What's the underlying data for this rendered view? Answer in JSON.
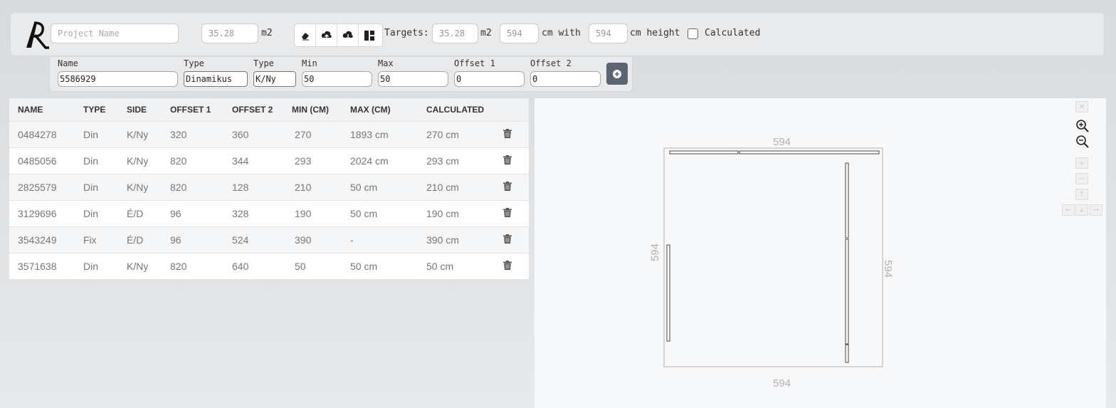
{
  "toolbar": {
    "project_name_placeholder": "Project Name",
    "area_value": "35.28",
    "area_unit": "m2",
    "targets_label": "Targets:",
    "target_area_value": "35.28",
    "target_area_unit": "m2",
    "width_value": "594",
    "width_suffix": "cm with",
    "height_value": "594",
    "height_suffix": "cm height",
    "calculated_label": "Calculated",
    "calculated_checked": false,
    "icons": [
      "eraser-icon",
      "cloud-upload-icon",
      "cloud-download-icon",
      "layout-icon"
    ]
  },
  "form": {
    "name_label": "Name",
    "name_value": "5586929",
    "type_label": "Type",
    "type_value": "Dinamikus",
    "type2_label": "Type",
    "type2_value": "K/Ny",
    "min_label": "Min",
    "min_value": "50",
    "max_label": "Max",
    "max_value": "50",
    "offset1_label": "Offset 1",
    "offset1_value": "0",
    "offset2_label": "Offset 2",
    "offset2_value": "0"
  },
  "table": {
    "headers": [
      "NAME",
      "TYPE",
      "SIDE",
      "OFFSET 1",
      "OFFSET 2",
      "MIN (CM)",
      "MAX (CM)",
      "CALCULATED"
    ],
    "rows": [
      [
        "0484278",
        "Din",
        "K/Ny",
        "320",
        "360",
        "270",
        "1893 cm",
        "270 cm"
      ],
      [
        "0485056",
        "Din",
        "K/Ny",
        "820",
        "344",
        "293",
        "2024 cm",
        "293 cm"
      ],
      [
        "2825579",
        "Din",
        "K/Ny",
        "820",
        "128",
        "210",
        "50 cm",
        "210 cm"
      ],
      [
        "3129696",
        "Din",
        "É/D",
        "96",
        "328",
        "190",
        "50 cm",
        "190 cm"
      ],
      [
        "3543249",
        "Fix",
        "É/D",
        "96",
        "524",
        "390",
        "-",
        "390 cm"
      ],
      [
        "3571638",
        "Din",
        "K/Ny",
        "820",
        "640",
        "50",
        "50 cm",
        "50 cm"
      ]
    ]
  },
  "canvas": {
    "dim_top": "594",
    "dim_bottom": "594",
    "dim_left": "594",
    "dim_right": "594"
  }
}
